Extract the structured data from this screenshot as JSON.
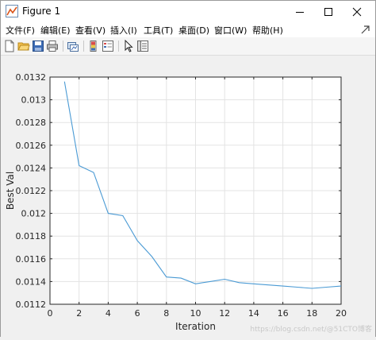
{
  "window": {
    "title": "Figure 1"
  },
  "menu": {
    "items": [
      "文件(F)",
      "编辑(E)",
      "查看(V)",
      "插入(I)",
      "工具(T)",
      "桌面(D)",
      "窗口(W)",
      "帮助(H)"
    ]
  },
  "toolbar": {
    "icons": [
      "new-figure-icon",
      "open-file-icon",
      "save-icon",
      "print-icon",
      "link-plot-icon",
      "insert-colorbar-icon",
      "insert-legend-icon",
      "edit-plot-arrow-icon",
      "property-inspector-icon"
    ]
  },
  "watermark": "https://blog.csdn.net/@51CTO博客",
  "colors": {
    "line": "#4a9ad4",
    "grid": "#e3e3e3",
    "axes": "#262626"
  },
  "chart_data": {
    "type": "line",
    "title": "",
    "xlabel": "Iteration",
    "ylabel": "Best Val",
    "xlim": [
      0,
      20
    ],
    "ylim": [
      0.0112,
      0.0132
    ],
    "xticks": [
      "0",
      "2",
      "4",
      "6",
      "8",
      "10",
      "12",
      "14",
      "16",
      "18",
      "20"
    ],
    "yticks": [
      "0.0112",
      "0.0114",
      "0.0116",
      "0.0118",
      "0.012",
      "0.0122",
      "0.0124",
      "0.0126",
      "0.0128",
      "0.013",
      "0.0132"
    ],
    "grid": true,
    "series": [
      {
        "x": [
          1,
          2,
          3,
          4,
          5,
          6,
          7,
          8,
          9,
          10,
          11,
          12,
          13,
          14,
          15,
          16,
          17,
          18,
          19,
          20
        ],
        "values": [
          0.01316,
          0.01242,
          0.01236,
          0.012,
          0.01198,
          0.01176,
          0.01162,
          0.01144,
          0.01143,
          0.01138,
          0.0114,
          0.01142,
          0.01139,
          0.01138,
          0.01137,
          0.01136,
          0.01135,
          0.01134,
          0.01135,
          0.01136
        ]
      }
    ]
  }
}
